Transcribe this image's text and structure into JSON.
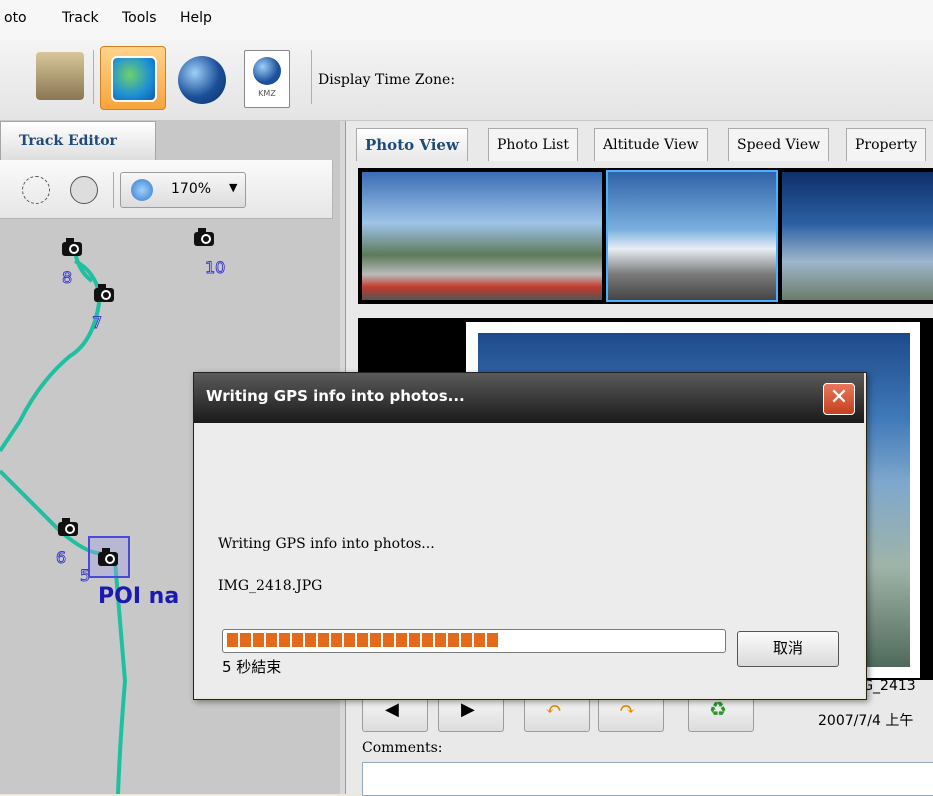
{
  "menu": {
    "items": [
      "oto",
      "Track",
      "Tools",
      "Help"
    ]
  },
  "toolbar": {
    "timezone_label": "Display Time Zone:",
    "kmz_label": "KMZ"
  },
  "left_pane": {
    "tab_label": "Track Editor",
    "zoom_value": "170%",
    "poi_numbers": [
      "8",
      "10",
      "7",
      "6",
      "5"
    ],
    "poi_label": "POI na"
  },
  "right_pane": {
    "tabs": [
      "Photo View",
      "Photo List",
      "Altitude View",
      "Speed View",
      "Property"
    ],
    "active_tab": "Photo View",
    "photo_name": "IMG_2413",
    "photo_date": "2007/7/4 上午",
    "comments_label": "Comments:"
  },
  "dialog": {
    "title": "Writing GPS info into photos...",
    "message": "Writing GPS info into photos...",
    "file": "IMG_2418.JPG",
    "cancel_label": "取消",
    "remaining": "5 秒結束",
    "progress": 0.55
  },
  "colors": {
    "track_line": "#1fc0a0",
    "progress": "#e26a1a",
    "accent": "#1f4a7a"
  },
  "icons": [
    "photo-icon",
    "map-icon",
    "google-earth-icon",
    "kmz-icon",
    "zoom-out-icon",
    "zoom-fit-icon",
    "zoom-icon",
    "prev-icon",
    "next-icon",
    "rotate-left-icon",
    "rotate-right-icon",
    "recycle-icon",
    "close-icon",
    "camera-icon"
  ]
}
